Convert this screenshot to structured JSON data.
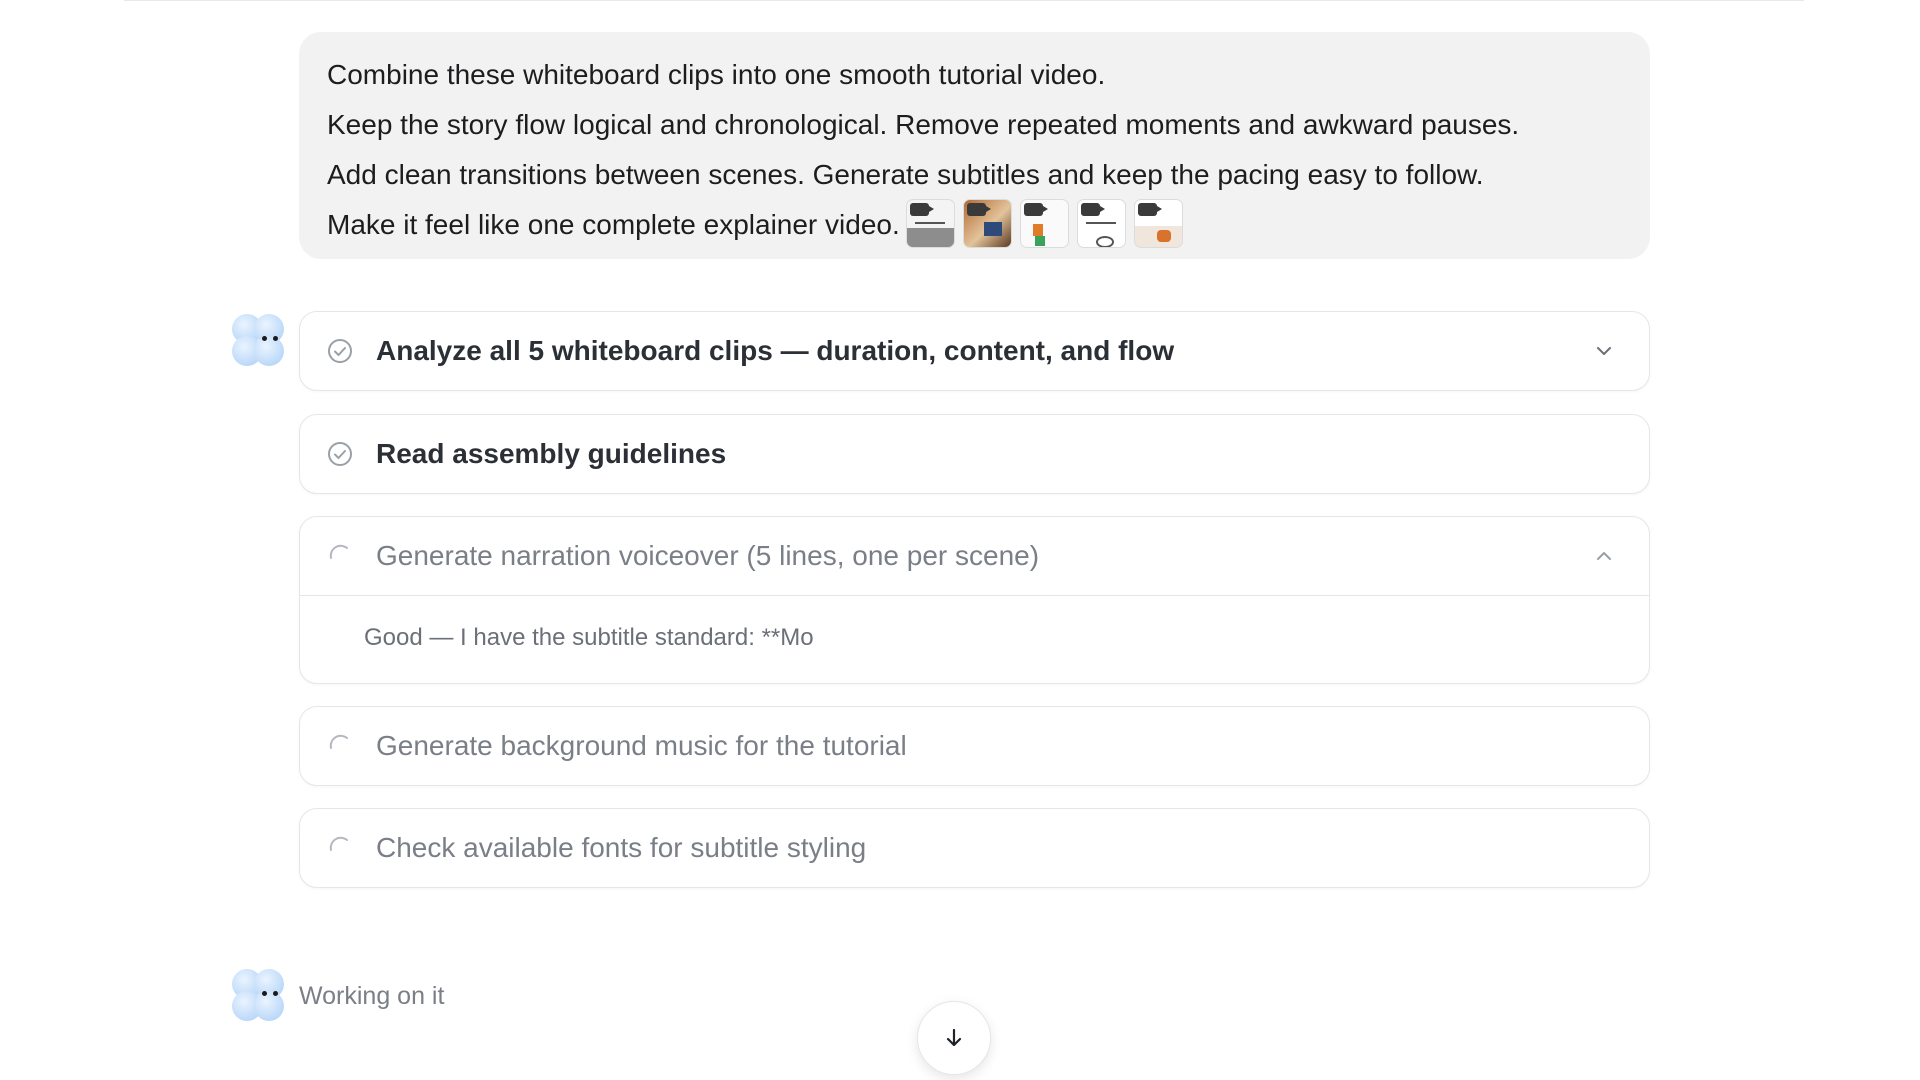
{
  "user_message": {
    "lines": [
      "Combine these whiteboard clips into one smooth tutorial video.",
      "Keep the story flow logical and chronological. Remove repeated moments and awkward pauses.",
      "Add clean transitions between scenes. Generate subtitles and keep the pacing easy to follow.",
      "Make it feel like one complete explainer video."
    ],
    "attachments_count": 5
  },
  "steps": [
    {
      "title": "Analyze all 5 whiteboard clips — duration, content, and flow",
      "status": "done",
      "expanded": false
    },
    {
      "title": "Read assembly guidelines",
      "status": "done"
    },
    {
      "title": "Generate narration voiceover (5 lines, one per scene)",
      "status": "in_progress",
      "expanded": true,
      "detail": "Good — I have the subtitle standard: **Mo"
    },
    {
      "title": "Generate background music for the tutorial",
      "status": "pending"
    },
    {
      "title": "Check available fonts for subtitle styling",
      "status": "pending"
    }
  ],
  "status": {
    "text": "Working on it"
  },
  "icons": {
    "done": "check-circle-icon",
    "pending": "spinner-icon",
    "expand": "chevron-down-icon",
    "collapse": "chevron-up-icon",
    "scroll": "arrow-down-icon"
  },
  "colors": {
    "bubble_bg": "#f2f2f2",
    "card_border": "#e4e6ea",
    "done_text": "#2b2f36",
    "pending_text": "#7a7f87",
    "avatar": "#a9cdf6"
  }
}
